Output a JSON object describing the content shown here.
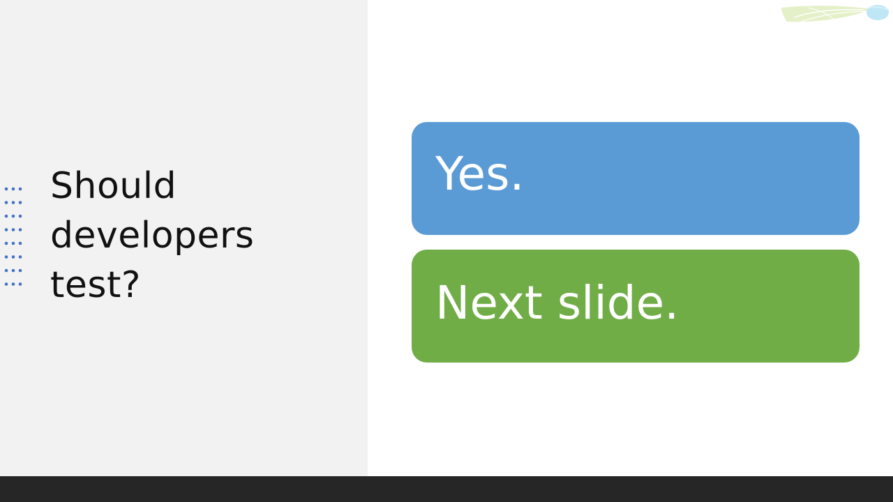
{
  "slide": {
    "title": "Should\ndevelopers\ntest?",
    "answers": [
      {
        "text": "Yes.",
        "color": "#5b9bd5"
      },
      {
        "text": "Next slide.",
        "color": "#70ad47"
      }
    ]
  },
  "theme": {
    "left_panel_color": "#f2f2f2",
    "dot_color": "#4472c4",
    "bottom_bar_color": "#262626"
  },
  "decorations": {
    "dot_pattern_icon": "dotted-grid-icon",
    "leaf_icon": "leaf-swoosh-icon"
  }
}
